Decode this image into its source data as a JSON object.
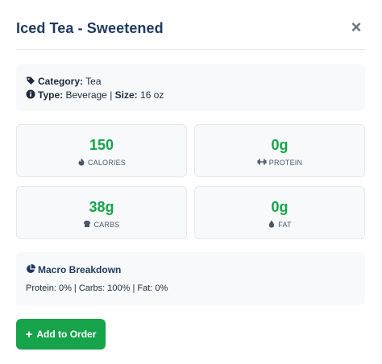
{
  "modal": {
    "title": "Iced Tea - Sweetened",
    "close_label": "×"
  },
  "info": {
    "category_label": "Category:",
    "category_value": "Tea",
    "type_label": "Type:",
    "type_value": "Beverage",
    "separator": "|",
    "size_label": "Size:",
    "size_value": "16 oz"
  },
  "stats": [
    {
      "value": "150",
      "label": "CALORIES",
      "icon": "fire-icon"
    },
    {
      "value": "0g",
      "label": "PROTEIN",
      "icon": "dumbbell-icon"
    },
    {
      "value": "38g",
      "label": "CARBS",
      "icon": "bread-icon"
    },
    {
      "value": "0g",
      "label": "FAT",
      "icon": "droplet-icon"
    }
  ],
  "macro": {
    "title": "Macro Breakdown",
    "text": "Protein: 0% | Carbs: 100% | Fat: 0%"
  },
  "actions": {
    "add_label": "Add to Order",
    "add_icon": "+"
  },
  "colors": {
    "accent": "#16a34a",
    "title": "#1e3a5f",
    "card_bg": "#f8f9fb"
  }
}
